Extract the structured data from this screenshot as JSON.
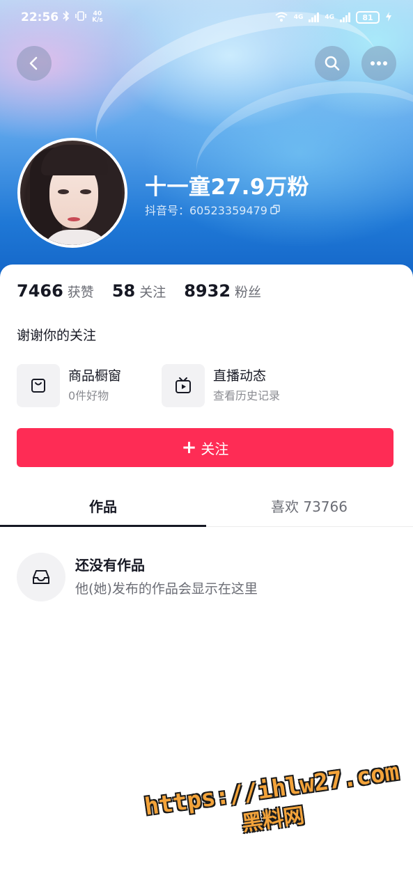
{
  "status_bar": {
    "time": "22:56",
    "net_speed_top": "40",
    "net_speed_bottom": "K/s",
    "signal1_label": "4G",
    "signal2_label": "4G",
    "battery": "81"
  },
  "header": {
    "back_icon": "chevron-left-icon",
    "search_icon": "search-icon",
    "more_icon": "more-dots-icon"
  },
  "profile": {
    "nickname": "十一童27.9万粉",
    "douyin_id": "抖音号：60523359479",
    "copy_icon": "copy-icon"
  },
  "stats": [
    {
      "num": "7466",
      "label": "获赞"
    },
    {
      "num": "58",
      "label": "关注"
    },
    {
      "num": "8932",
      "label": "粉丝"
    }
  ],
  "bio": "谢谢你的关注",
  "features": [
    {
      "title": "商品橱窗",
      "sub": "0件好物",
      "icon": "shopping-bag-icon"
    },
    {
      "title": "直播动态",
      "sub": "查看历史记录",
      "icon": "tv-play-icon"
    }
  ],
  "follow_button": {
    "plus": "+",
    "label": "关注"
  },
  "tabs": [
    {
      "label": "作品",
      "active": true
    },
    {
      "label": "喜欢 73766",
      "active": false
    }
  ],
  "empty_state": {
    "title": "还没有作品",
    "subtitle": "他(她)发布的作品会显示在这里",
    "icon": "inbox-tray-icon"
  },
  "watermark": {
    "url": "https://ihlw27.com",
    "name": "黑料网"
  },
  "colors": {
    "accent": "#fe2c55",
    "hero_blue": "#1f78d6",
    "text_primary": "#161823",
    "text_secondary": "#6b6d75"
  }
}
